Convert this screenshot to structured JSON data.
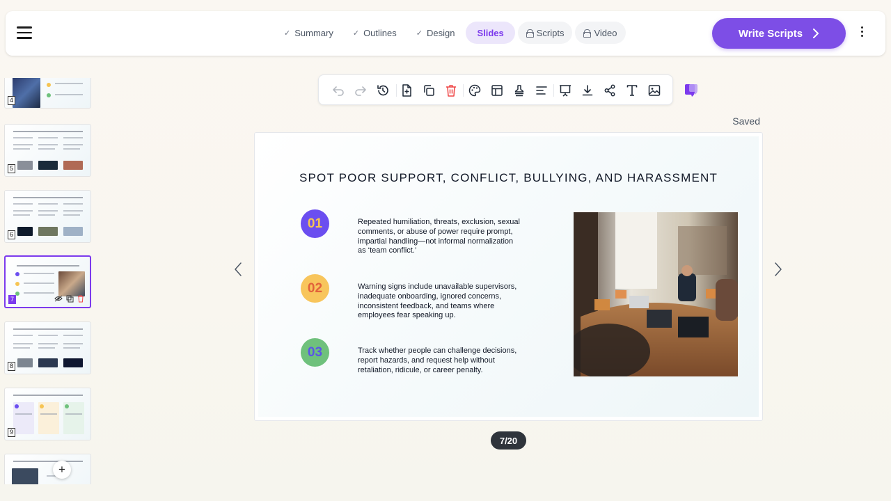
{
  "header": {
    "menu_icon": "hamburger-menu-icon",
    "steps": [
      {
        "label": "Summary",
        "state": "done"
      },
      {
        "label": "Outlines",
        "state": "done"
      },
      {
        "label": "Design",
        "state": "done"
      },
      {
        "label": "Slides",
        "state": "active"
      },
      {
        "label": "Scripts",
        "state": "locked"
      },
      {
        "label": "Video",
        "state": "locked"
      }
    ],
    "primary_action": "Write Scripts",
    "more_icon": "kebab-menu-icon"
  },
  "toolbar": {
    "tools": [
      "undo-icon",
      "redo-icon",
      "history-icon",
      "new-slide-icon",
      "duplicate-icon",
      "delete-icon",
      "theme-palette-icon",
      "layout-icon",
      "stamp-icon",
      "align-icon",
      "present-icon",
      "download-icon",
      "share-icon",
      "text-icon",
      "image-icon"
    ],
    "brand_icon": "brand-logo-icon",
    "status": "Saved"
  },
  "sidebar": {
    "thumbnails": [
      {
        "number": "4"
      },
      {
        "number": "5"
      },
      {
        "number": "6"
      },
      {
        "number": "7",
        "selected": true
      },
      {
        "number": "8"
      },
      {
        "number": "9"
      },
      {
        "number": ""
      }
    ],
    "add_icon": "plus-icon"
  },
  "slide": {
    "title": "SPOT POOR SUPPORT, CONFLICT, BULLYING, AND HARASSMENT",
    "points": [
      {
        "badge": "01",
        "color": "#6b4ef0",
        "text_color": "#f6c453",
        "text": "Repeated humiliation, threats, exclusion, sexual comments, or abuse of power require prompt, impartial handling—not informal normalization as ‘team conflict.’"
      },
      {
        "badge": "02",
        "color": "#f8c55c",
        "text_color": "#e2613a",
        "text": "Warning signs include unavailable supervisors, inadequate onboarding, ignored concerns, inconsistent feedback, and teams where employees fear speaking up."
      },
      {
        "badge": "03",
        "color": "#6fc17c",
        "text_color": "#5a55e6",
        "text": "Track whether people can challenge decisions, report hazards, and request help without retaliation, ridicule, or career penalty."
      }
    ],
    "photo": "meeting-room-photo"
  },
  "pager": "7/20",
  "colors": {
    "accent": "#7d4ee6",
    "delete": "#ef4444"
  }
}
